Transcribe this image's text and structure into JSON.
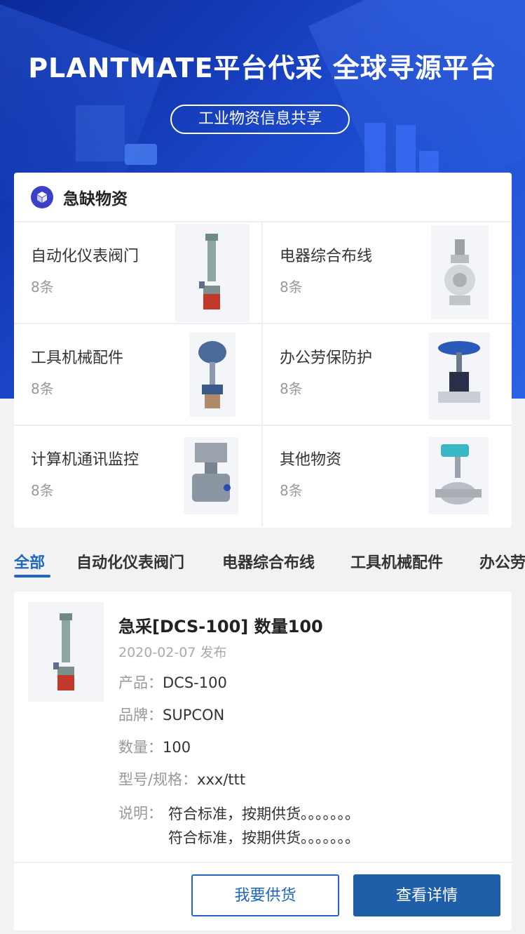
{
  "hero": {
    "title": "PLANTMATE平台代采  全球寻源平台",
    "subtitle": "工业物资信息共享"
  },
  "shortage": {
    "title": "急缺物资",
    "icon": "cube-icon",
    "categories": [
      {
        "label": "自动化仪表阀门",
        "count": "8条",
        "icon": "valve-actuator-image"
      },
      {
        "label": "电器综合布线",
        "count": "8条",
        "icon": "ball-valve-image"
      },
      {
        "label": "工具机械配件",
        "count": "8条",
        "icon": "control-valve-image"
      },
      {
        "label": "办公劳保防护",
        "count": "8条",
        "icon": "gate-valve-image"
      },
      {
        "label": "计算机通讯监控",
        "count": "8条",
        "icon": "pneumatic-valve-image"
      },
      {
        "label": "其他物资",
        "count": "8条",
        "icon": "electric-valve-image"
      }
    ]
  },
  "tabs": [
    "全部",
    "自动化仪表阀门",
    "电器综合布线",
    "工具机械配件",
    "办公劳保防护"
  ],
  "active_tab": "全部",
  "listing": {
    "title": "急采[DCS-100] 数量100",
    "date": "2020-02-07 发布",
    "fields": [
      {
        "key": "产品：",
        "value": "DCS-100"
      },
      {
        "key": "品牌：",
        "value": "SUPCON"
      },
      {
        "key": "数量：",
        "value": "100"
      },
      {
        "key": "型号/规格：",
        "value": "xxx/ttt"
      }
    ],
    "description_label": "说明：",
    "description_lines": [
      "符合标准，按期供货。。。。。。。",
      "符合标准，按期供货。。。。。。。"
    ],
    "supply_button": "我要供货",
    "detail_button": "查看详情"
  },
  "colors": {
    "accent": "#1f66c1",
    "hero": "#1a46c8",
    "icon_bg": "#3a41c8"
  }
}
